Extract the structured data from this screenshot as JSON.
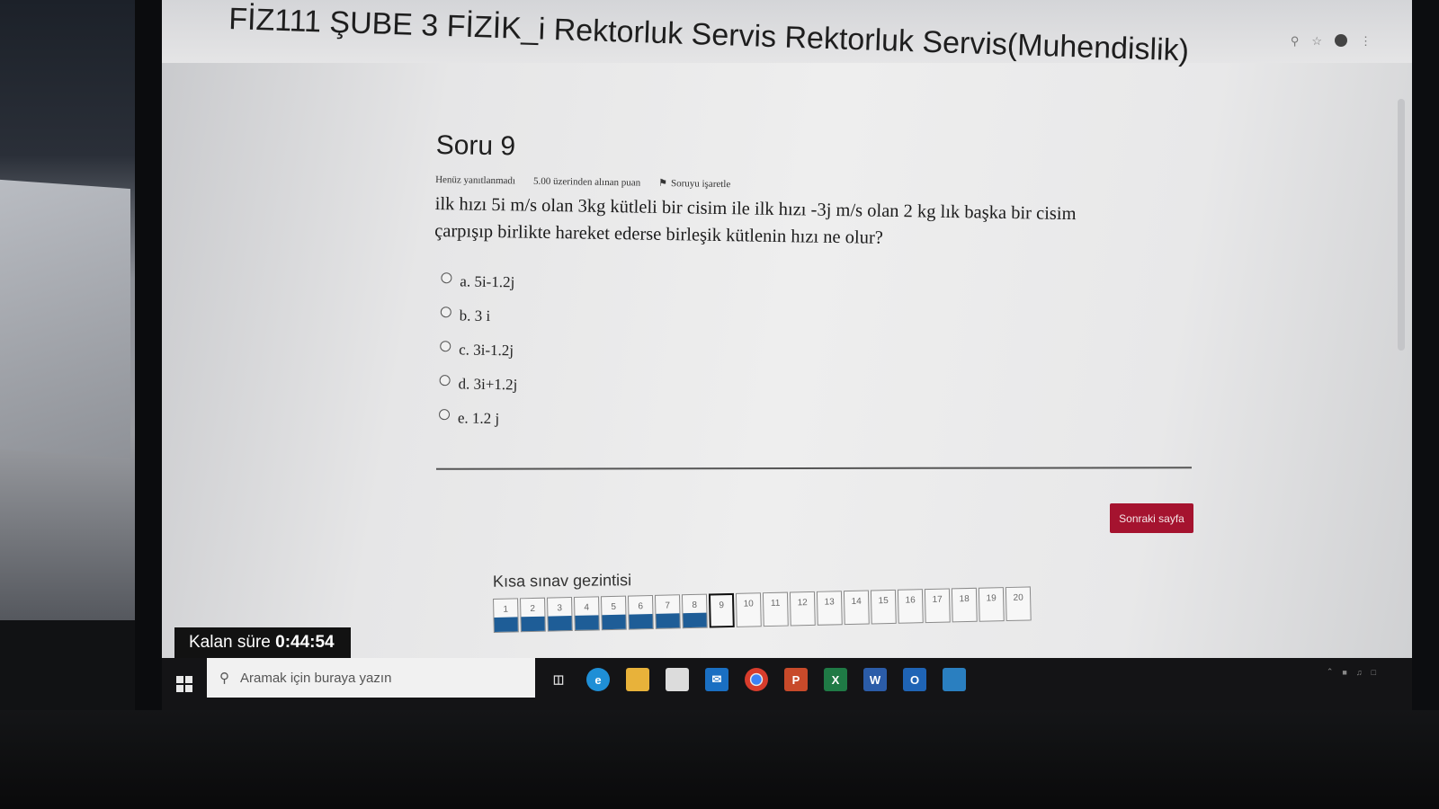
{
  "page": {
    "title": "FİZ111 ŞUBE 3 FİZİK_i Rektorluk Servis Rektorluk Servis(Muhendislik)"
  },
  "question": {
    "number_label": "Soru 9",
    "status": "Henüz yanıtlanmadı",
    "points": "5.00 üzerinden alınan puan",
    "flag_label": "Soruyu işaretle",
    "line1": "ilk hızı 5i m/s olan 3kg kütleli bir cisim ile ilk hızı -3j m/s olan 2 kg lık başka bir cisim",
    "line2": "çarpışıp birlikte hareket ederse birleşik kütlenin hızı ne olur?",
    "options": [
      {
        "label": "a. 5i-1.2j"
      },
      {
        "label": "b. 3 i"
      },
      {
        "label": "c. 3i-1.2j"
      },
      {
        "label": "d. 3i+1.2j"
      },
      {
        "label": "e. 1.2 j"
      }
    ]
  },
  "next_button": "Sonraki sayfa",
  "navigation": {
    "title": "Kısa sınav gezintisi",
    "items": [
      {
        "label": "1",
        "answered": true
      },
      {
        "label": "2",
        "answered": true
      },
      {
        "label": "3",
        "answered": true
      },
      {
        "label": "4",
        "answered": true
      },
      {
        "label": "5",
        "answered": true
      },
      {
        "label": "6",
        "answered": true
      },
      {
        "label": "7",
        "answered": true
      },
      {
        "label": "8",
        "answered": true
      },
      {
        "label": "9",
        "answered": false,
        "current": true
      },
      {
        "label": "10",
        "answered": false
      },
      {
        "label": "11",
        "answered": false
      },
      {
        "label": "12",
        "answered": false
      },
      {
        "label": "13",
        "answered": false
      },
      {
        "label": "14",
        "answered": false
      },
      {
        "label": "15",
        "answered": false
      },
      {
        "label": "16",
        "answered": false
      },
      {
        "label": "17",
        "answered": false
      },
      {
        "label": "18",
        "answered": false
      },
      {
        "label": "19",
        "answered": false
      },
      {
        "label": "20",
        "answered": false
      }
    ]
  },
  "timer": {
    "label": "Kalan süre",
    "value": "0:44:54"
  },
  "taskbar": {
    "search_placeholder": "Aramak için buraya yazın",
    "apps": [
      "task-view",
      "edge",
      "file-explorer",
      "store",
      "mail",
      "chrome",
      "powerpoint",
      "excel",
      "word",
      "outlook",
      "other-app"
    ]
  },
  "colors": {
    "accent": "#a5132f",
    "answered": "#1e5d97"
  }
}
